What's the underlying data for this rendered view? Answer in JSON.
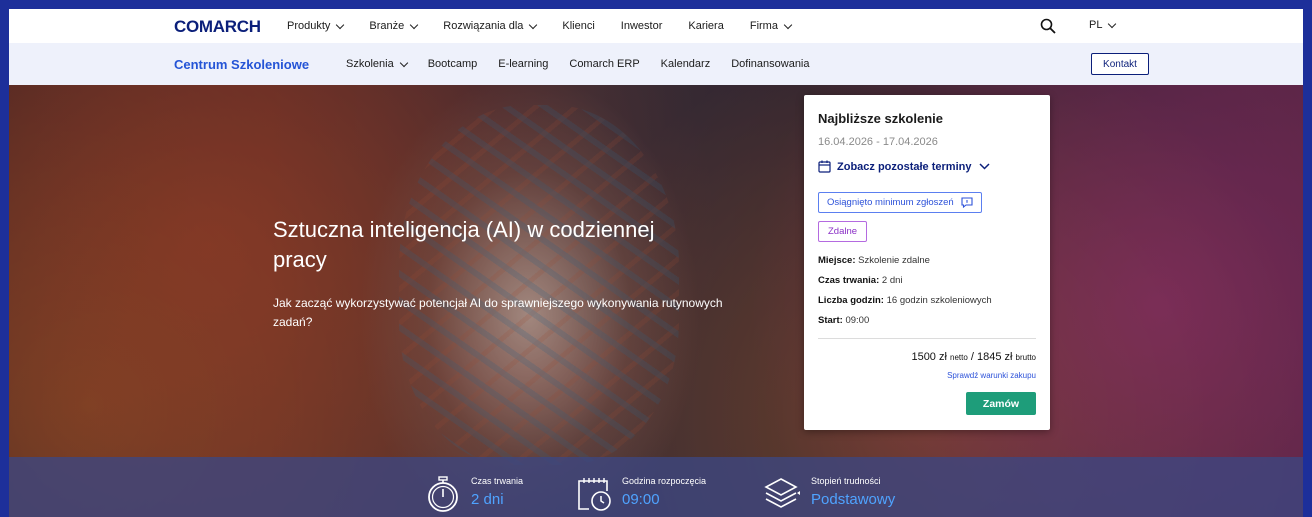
{
  "topnav": {
    "logo": "COMARCH",
    "items": [
      {
        "label": "Produkty",
        "dropdown": true
      },
      {
        "label": "Branże",
        "dropdown": true
      },
      {
        "label": "Rozwiązania dla",
        "dropdown": true
      },
      {
        "label": "Klienci",
        "dropdown": false
      },
      {
        "label": "Inwestor",
        "dropdown": false
      },
      {
        "label": "Kariera",
        "dropdown": false
      },
      {
        "label": "Firma",
        "dropdown": true
      }
    ],
    "lang": "PL"
  },
  "subnav": {
    "brand": "Centrum Szkoleniowe",
    "items": [
      "Szkolenia",
      "Bootcamp",
      "E-learning",
      "Comarch ERP",
      "Kalendarz",
      "Dofinansowania"
    ],
    "contact": "Kontakt"
  },
  "hero": {
    "title": "Sztuczna inteligencja (AI) w codziennej pracy",
    "subtitle": "Jak zacząć wykorzystywać potencjał AI do sprawniejszego wykonywania rutynowych zadań?"
  },
  "card": {
    "title": "Najbliższe szkolenie",
    "dates": "16.04.2026 - 17.04.2026",
    "more_dates": "Zobacz pozostałe terminy",
    "tag_minimum": "Osiągnięto minimum zgłoszeń",
    "tag_mode": "Zdalne",
    "place_label": "Miejsce:",
    "place_value": "Szkolenie zdalne",
    "duration_label": "Czas trwania:",
    "duration_value": "2 dni",
    "hours_label": "Liczba godzin:",
    "hours_value": "16 godzin szkoleniowych",
    "start_label": "Start:",
    "start_value": "09:00",
    "price_net": "1500 zł",
    "net_label": "netto",
    "price_sep": "/",
    "price_gross": "1845 zł",
    "gross_label": "brutto",
    "terms": "Sprawdź warunki zakupu",
    "order": "Zamów"
  },
  "stats": [
    {
      "label": "Czas trwania",
      "value": "2 dni",
      "icon": "stopwatch-icon"
    },
    {
      "label": "Godzina rozpoczęcia",
      "value": "09:00",
      "icon": "calendar-clock-icon"
    },
    {
      "label": "Stopień trudności",
      "value": "Podstawowy",
      "icon": "layers-icon"
    }
  ],
  "colors": {
    "frame": "#1d2f9a",
    "brand": "#2454d6",
    "logo": "#0b1f7a",
    "order_button": "#1e9d7a",
    "stat_value": "#4fa3ff"
  }
}
